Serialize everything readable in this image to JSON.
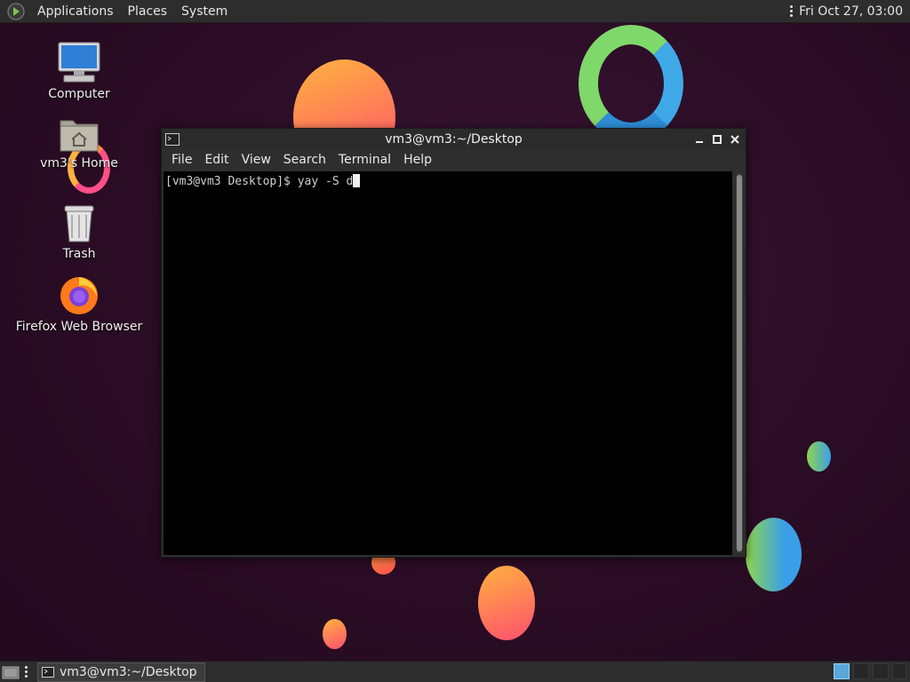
{
  "top_panel": {
    "menus": [
      "Applications",
      "Places",
      "System"
    ],
    "clock": "Fri Oct 27, 03:00",
    "logo_icon": "gnome-foot-icon"
  },
  "desktop": {
    "icons": [
      {
        "label": "Computer",
        "icon": "computer-icon"
      },
      {
        "label": "vm3's Home",
        "icon": "home-folder-icon"
      },
      {
        "label": "Trash",
        "icon": "trash-icon"
      },
      {
        "label": "Firefox Web Browser",
        "icon": "firefox-icon"
      }
    ]
  },
  "terminal": {
    "title": "vm3@vm3:~/Desktop",
    "menus": [
      "File",
      "Edit",
      "View",
      "Search",
      "Terminal",
      "Help"
    ],
    "line": "[vm3@vm3 Desktop]$ yay -S d"
  },
  "bottom_panel": {
    "task_label": "vm3@vm3:~/Desktop"
  },
  "colors": {
    "panel": "#2d2d2d",
    "background": "#2b0e25",
    "terminal_bg": "#000000",
    "accent": "#5aa7d8"
  }
}
